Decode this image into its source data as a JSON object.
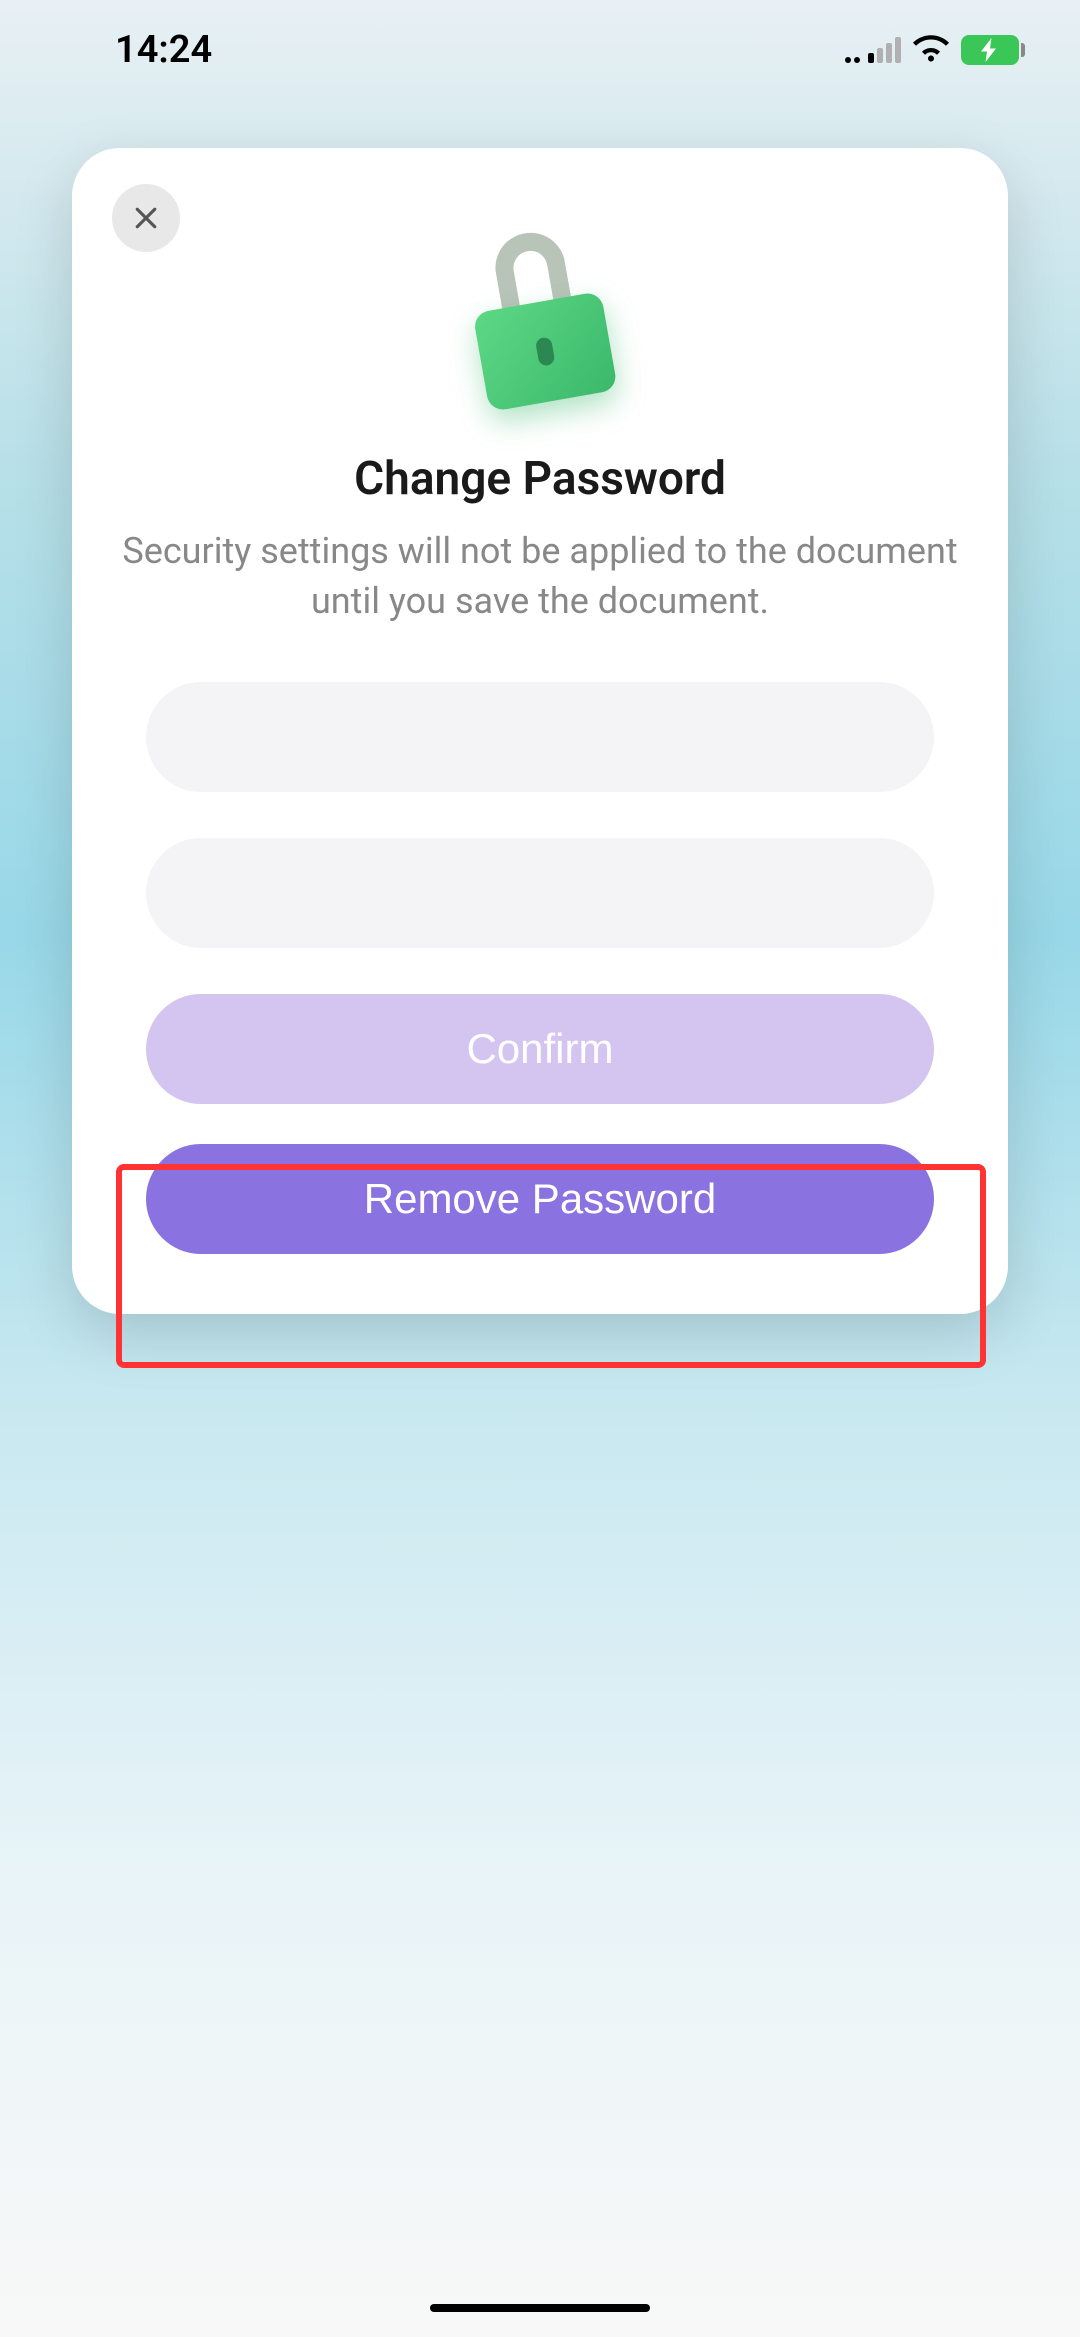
{
  "status_bar": {
    "time": "14:24"
  },
  "modal": {
    "title": "Change Password",
    "description": "Security settings will not be applied to the document until you save the document.",
    "input1_value": "",
    "input2_value": "",
    "confirm_label": "Confirm",
    "remove_label": "Remove Password"
  },
  "highlight": {
    "target": "remove-password-button"
  }
}
